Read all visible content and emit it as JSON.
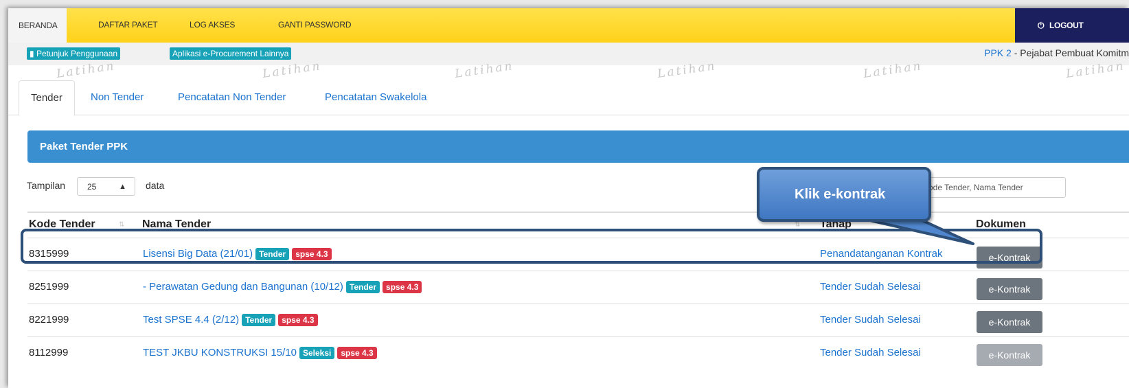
{
  "topnav": {
    "items": [
      "BERANDA",
      "DAFTAR PAKET",
      "LOG AKSES",
      "GANTI PASSWORD"
    ],
    "logout": "LOGOUT"
  },
  "subbar": {
    "guide": "Petunjuk Penggunaan",
    "other_apps": "Aplikasi e-Procurement Lainnya",
    "role_code": "PPK 2",
    "role_desc": " - Pejabat Pembuat Komitm"
  },
  "watermark": "Latihan",
  "tabs": [
    "Tender",
    "Non Tender",
    "Pencatatan Non Tender",
    "Pencatatan Swakelola"
  ],
  "panel_title": "Paket Tender PPK",
  "length": {
    "label": "Tampilan",
    "value": "25",
    "suffix": "data"
  },
  "search_placeholder": "Kode Tender, Nama Tender",
  "columns": [
    "Kode Tender",
    "Nama Tender",
    "Tahap",
    "Dokumen"
  ],
  "rows": [
    {
      "kode": "8315999",
      "nama": "Lisensi Big Data (21/01)",
      "badge1": "Tender",
      "badge2": "spse 4.3",
      "tahap": "Penandatanganan Kontrak",
      "dok": "e-Kontrak"
    },
    {
      "kode": "8251999",
      "nama": "- Perawatan Gedung dan Bangunan (10/12)",
      "badge1": "Tender",
      "badge2": "spse 4.3",
      "tahap": "Tender Sudah Selesai",
      "dok": "e-Kontrak"
    },
    {
      "kode": "8221999",
      "nama": "Test SPSE 4.4 (2/12)",
      "badge1": "Tender",
      "badge2": "spse 4.3",
      "tahap": "Tender Sudah Selesai",
      "dok": "e-Kontrak"
    },
    {
      "kode": "8112999",
      "nama": "TEST JKBU KONSTRUKSI 15/10",
      "badge1": "Seleksi",
      "badge2": "spse 4.3",
      "tahap": "Tender Sudah Selesai",
      "dok": "e-Kontrak"
    }
  ],
  "callout": "Klik e-kontrak",
  "colors": {
    "nav": "#ffd21a",
    "logout_bg": "#1b1f5e",
    "panel": "#3a8fd0",
    "teal": "#17a2b8",
    "red": "#dc3545",
    "link": "#1a72cf",
    "callout": "#4f86cd"
  }
}
